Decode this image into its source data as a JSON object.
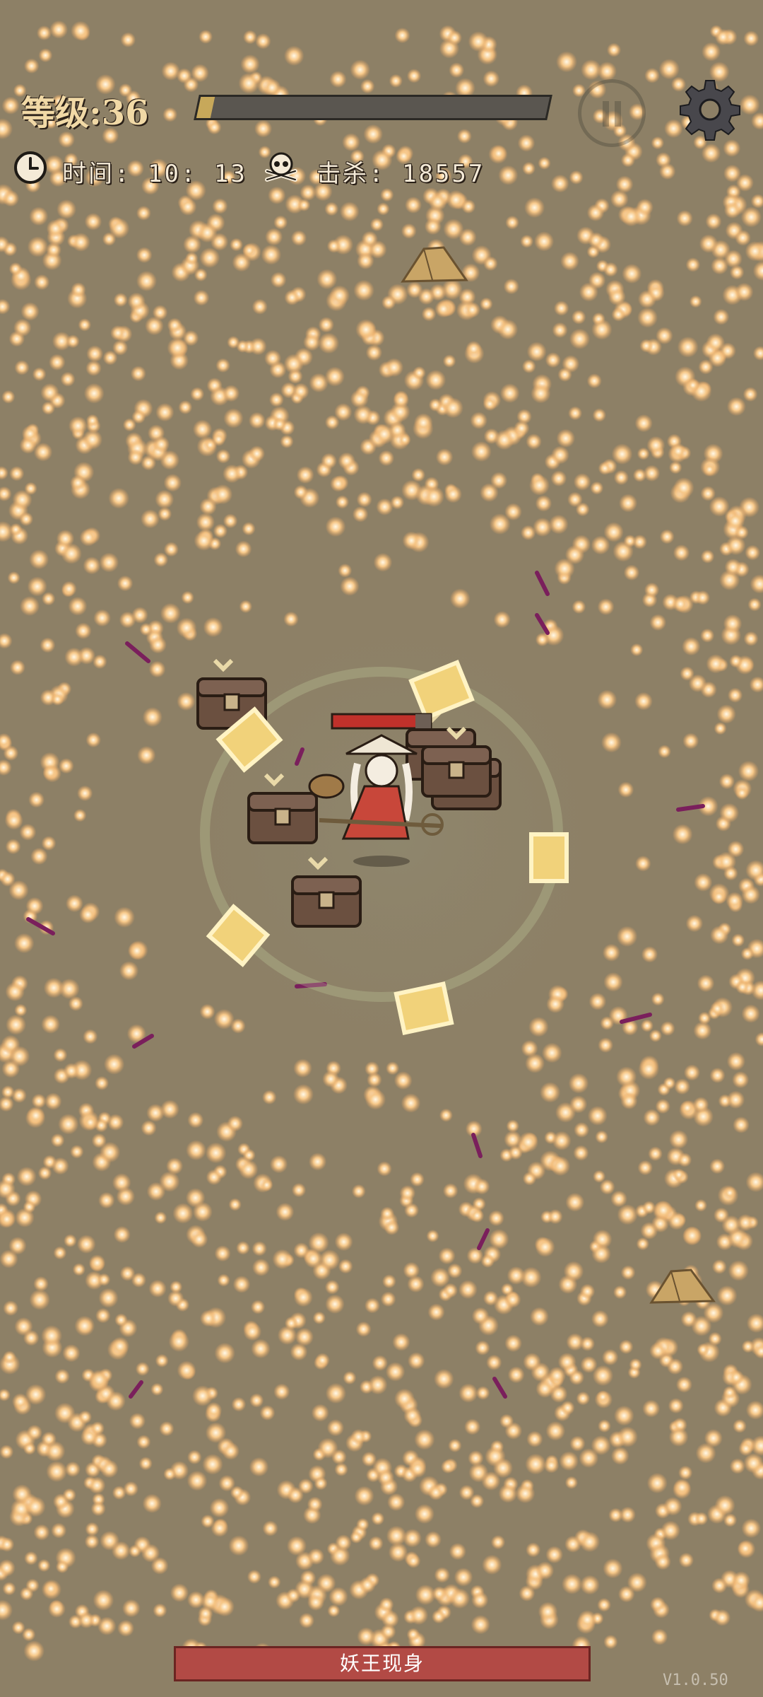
{
  "hud": {
    "level_label": "等级:",
    "level_value": "36",
    "xp_fraction": 0.04,
    "time_label": "时间:",
    "time_value": "10: 13",
    "kills_label": "击杀:",
    "kills_value": "18557"
  },
  "icons": {
    "pause": "pause-icon",
    "settings": "gear-icon",
    "clock": "clock-icon",
    "kills": "skull-icon"
  },
  "banner": {
    "boss_text": "妖王现身"
  },
  "version": "V1.0.50",
  "colors": {
    "ground": "#8d8066",
    "orb": "#f7c98a",
    "xp_fill": "#c7a85a",
    "banner": "#b24a45",
    "talisman": "#f1d27a",
    "health": "#c0312b"
  }
}
